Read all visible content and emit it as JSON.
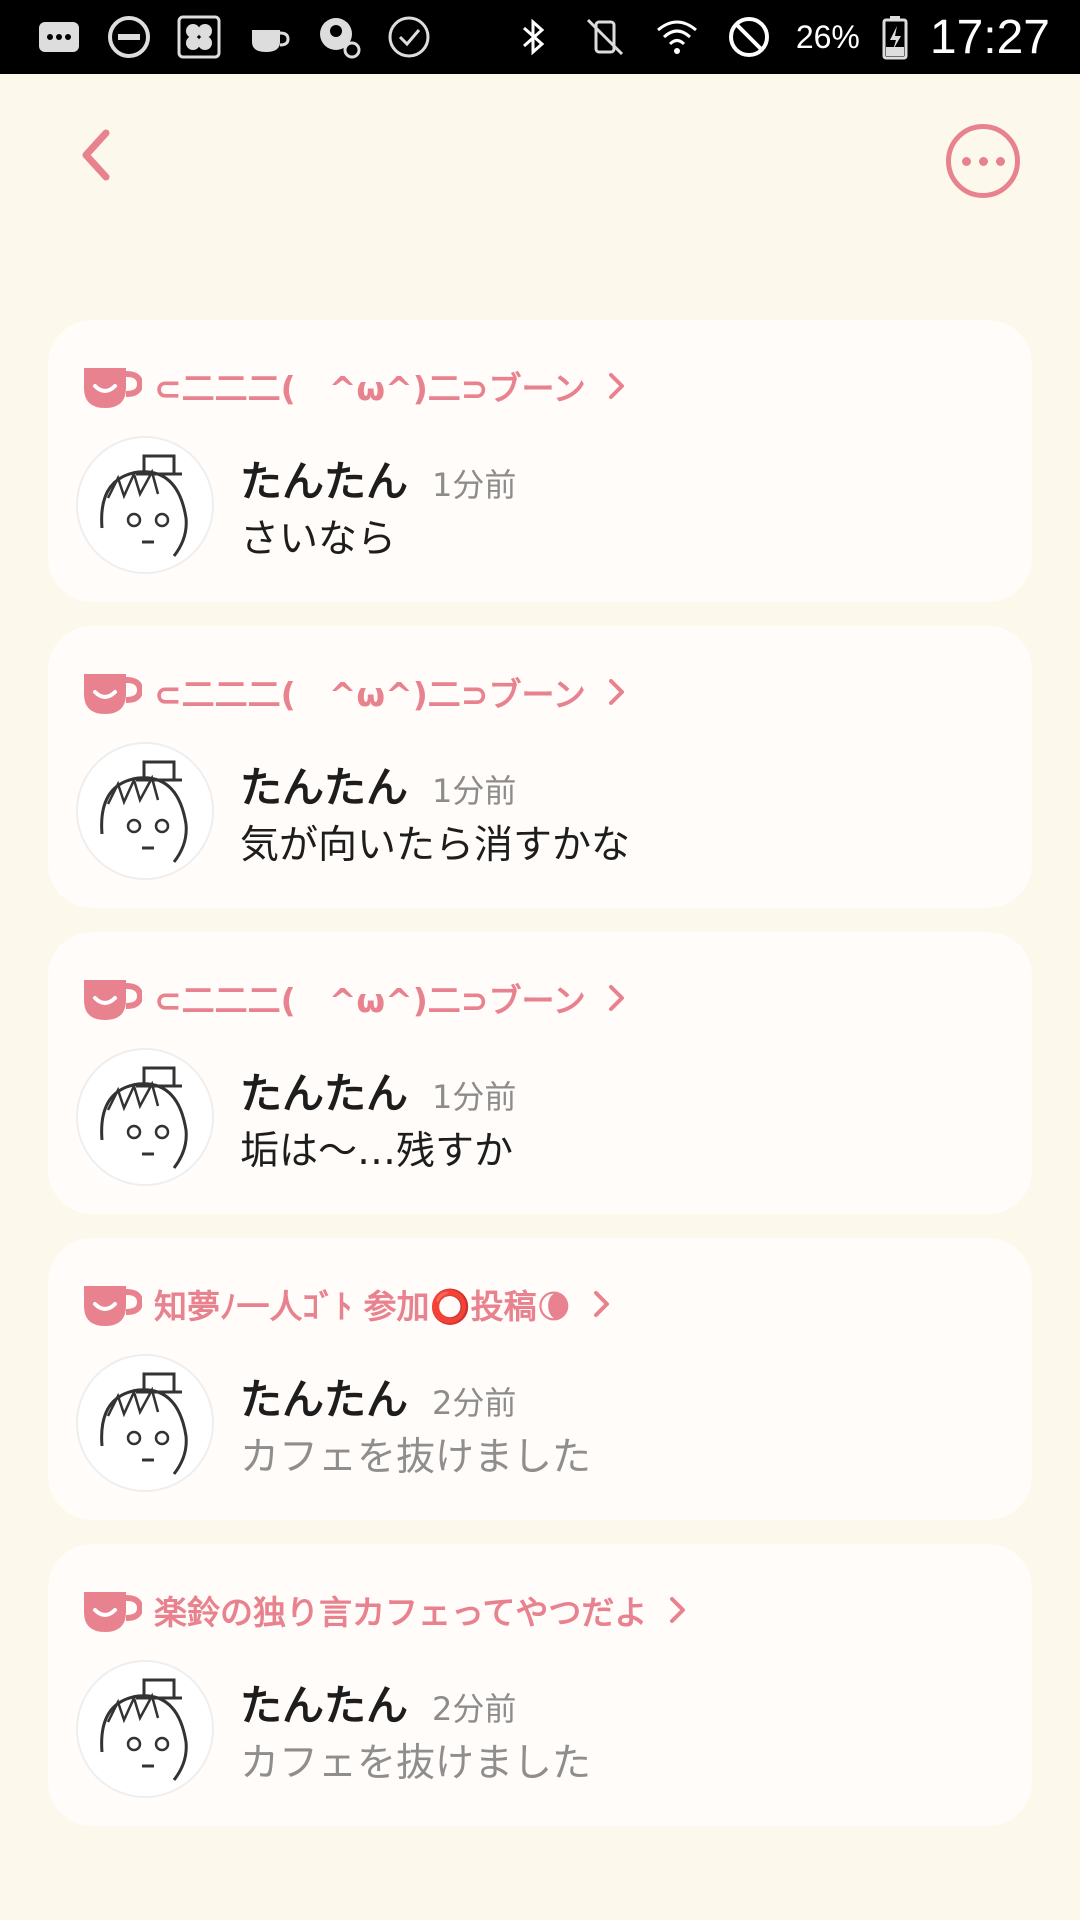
{
  "status_bar": {
    "icons_left": [
      "message-icon",
      "do-not-disturb-icon",
      "clover-app-icon",
      "cup-icon",
      "app-icon",
      "check-circle-icon"
    ],
    "icons_right": [
      "bluetooth-icon",
      "vibrate-off-icon",
      "wifi-icon",
      "block-icon"
    ],
    "battery": "26%",
    "time": "17:27"
  },
  "colors": {
    "accent": "#e9828f",
    "background": "#fdf8ec",
    "card": "#fffcf9"
  },
  "feed": {
    "items": [
      {
        "cafe": "⊂二二二(　^ω^)二⊃ブーン",
        "user": "たんたん",
        "time": "1分前",
        "message": "さいなら",
        "system": false
      },
      {
        "cafe": "⊂二二二(　^ω^)二⊃ブーン",
        "user": "たんたん",
        "time": "1分前",
        "message": "気が向いたら消すかな",
        "system": false
      },
      {
        "cafe": "⊂二二二(　^ω^)二⊃ブーン",
        "user": "たんたん",
        "time": "1分前",
        "message": "垢は〜…残すか",
        "system": false
      },
      {
        "cafe": "知夢ﾉ一人ｺﾞﾄ 参加⭕投稿🌘",
        "user": "たんたん",
        "time": "2分前",
        "message": "カフェを抜けました",
        "system": true
      },
      {
        "cafe": "楽鈴の独り言カフェってやつだよ",
        "user": "たんたん",
        "time": "2分前",
        "message": "カフェを抜けました",
        "system": true
      }
    ]
  }
}
